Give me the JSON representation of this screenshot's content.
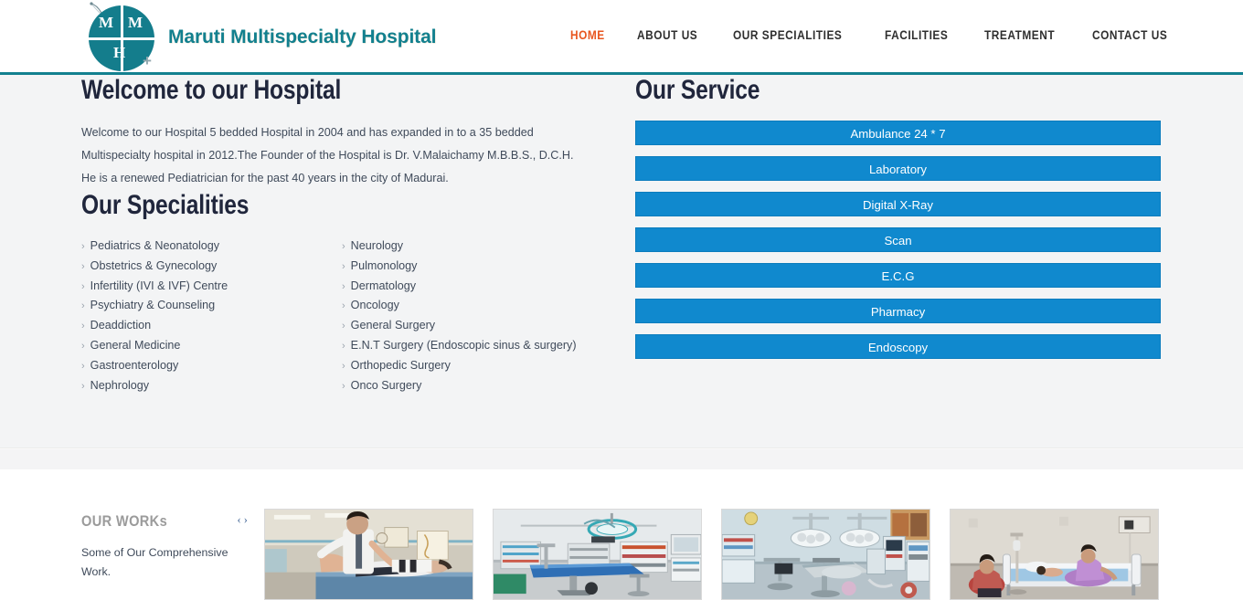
{
  "header": {
    "brand_title": "Maruti Multispecialty Hospital",
    "logo": {
      "letter_top_left": "M",
      "letter_top_right": "M",
      "letter_bottom": "H",
      "plus": "+"
    },
    "nav": [
      {
        "label": "HOME",
        "active": true
      },
      {
        "label": "ABOUT US",
        "active": false
      },
      {
        "label": "OUR SPECIALITIES",
        "active": false
      },
      {
        "label": "FACILITIES",
        "active": false
      },
      {
        "label": "TREATMENT",
        "active": false
      },
      {
        "label": "CONTACT US",
        "active": false
      }
    ]
  },
  "welcome": {
    "title": "Welcome to our Hospital",
    "paragraph": "Welcome to our Hospital 5 bedded Hospital in 2004 and has expanded in to a 35 bedded Multispecialty hospital in 2012.The Founder of the Hospital is Dr. V.Malaichamy M.B.B.S., D.C.H. He is a renewed Pediatrician for the past 40 years in the city of Madurai."
  },
  "specialities": {
    "title": "Our Specialities",
    "bullet": "›",
    "column_left": [
      "Pediatrics & Neonatology",
      "Obstetrics & Gynecology",
      "Infertility (IVI & IVF) Centre",
      "Psychiatry & Counseling",
      "Deaddiction",
      "General Medicine",
      "Gastroenterology",
      "Nephrology"
    ],
    "column_right": [
      "Neurology",
      "Pulmonology",
      "Dermatology",
      "Oncology",
      "General Surgery",
      "E.N.T Surgery (Endoscopic sinus & surgery)",
      "Orthopedic Surgery",
      "Onco Surgery"
    ]
  },
  "service": {
    "title": "Our Service",
    "items": [
      "Ambulance 24 * 7",
      "Laboratory",
      "Digital X-Ray",
      "Scan",
      "E.C.G",
      "Pharmacy",
      "Endoscopy"
    ]
  },
  "works": {
    "title": "OUR WORKs",
    "subtitle": "Some of Our Comprehensive Work.",
    "prev_arrow": "‹",
    "next_arrow": "›",
    "thumbnails": [
      {
        "alt": "physiotherapy-session-photo"
      },
      {
        "alt": "operation-theatre-blue-table-photo"
      },
      {
        "alt": "operation-theatre-equipment-photo"
      },
      {
        "alt": "patient-ward-bed-photo"
      }
    ]
  },
  "colors": {
    "brand_teal": "#12808f",
    "accent_orange": "#e8561f",
    "service_blue": "#1089ce",
    "heading_navy": "#20263c",
    "band_background": "#f3f4f5"
  }
}
